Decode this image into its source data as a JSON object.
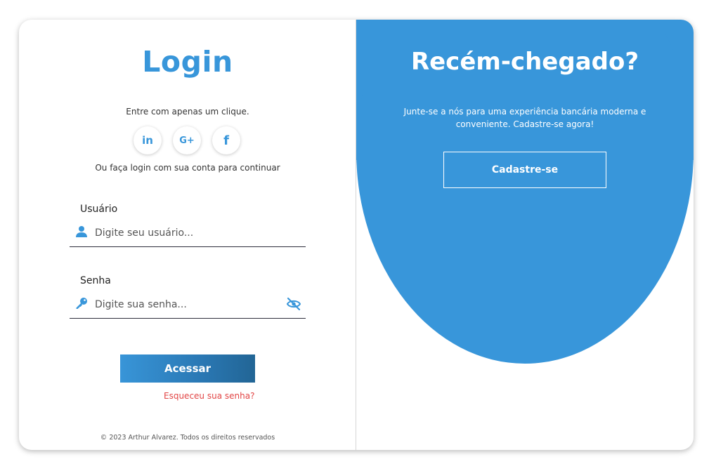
{
  "login": {
    "title": "Login",
    "one_click_text": "Entre com apenas um clique.",
    "social": [
      {
        "icon": "linkedin-icon",
        "glyph": "in"
      },
      {
        "icon": "google-plus-icon",
        "glyph": "G+"
      },
      {
        "icon": "facebook-icon",
        "glyph": "f"
      }
    ],
    "alt_text": "Ou faça login com sua conta para continuar",
    "username_label": "Usuário",
    "username_placeholder": "Digite seu usuário...",
    "password_label": "Senha",
    "password_placeholder": "Digite sua senha...",
    "submit_label": "Acessar",
    "forgot_label": "Esqueceu sua senha?",
    "footer": "© 2023 Arthur Alvarez. Todos os direitos reservados"
  },
  "signup": {
    "title": "Recém-chegado?",
    "text": "Junte-se a nós para uma experiência bancária moderna e conveniente. Cadastre-se agora!",
    "button_label": "Cadastre-se"
  },
  "colors": {
    "accent": "#3896da",
    "forgot": "#e24545",
    "underline": "#2d2d3a"
  }
}
